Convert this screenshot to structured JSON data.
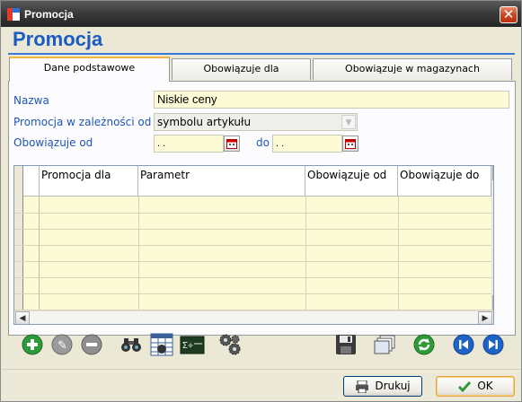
{
  "window": {
    "title": "Promocja",
    "close_glyph": "✕"
  },
  "page": {
    "title": "Promocja"
  },
  "tabs": [
    {
      "label": "Dane podstawowe",
      "active": true
    },
    {
      "label": "Obowiązuje dla",
      "active": false
    },
    {
      "label": "Obowiązuje w magazynach",
      "active": false
    }
  ],
  "form": {
    "name_label": "Nazwa",
    "name_value": "Niskie ceny",
    "depends_label": "Promocja w zależności od",
    "depends_value": "symbolu artykułu",
    "valid_from_label": "Obowiązuje od",
    "date_from_value": " .  .",
    "to_label": "do",
    "date_to_value": " .  ."
  },
  "grid": {
    "columns": [
      "Promocja dla",
      "Parametr",
      "Obowiązuje od",
      "Obowiązuje do"
    ],
    "rows": [
      [],
      [],
      [],
      [],
      [],
      [],
      []
    ]
  },
  "toolbar": {
    "left_icons": [
      "add-icon",
      "edit-icon",
      "remove-icon",
      "binoculars-icon",
      "table-filter-icon",
      "calculator-icon",
      "settings-cogs-icon"
    ],
    "right_icons": [
      "save-icon",
      "copy-icon",
      "refresh-icon",
      "previous-icon",
      "next-icon"
    ]
  },
  "buttons": {
    "print_label": "Drukuj",
    "ok_label": "OK"
  },
  "colors": {
    "accent": "#1a5bc4",
    "label": "#2055b5",
    "field_bg": "#fdfbd6",
    "tab_active_border": "#f3b23d"
  }
}
